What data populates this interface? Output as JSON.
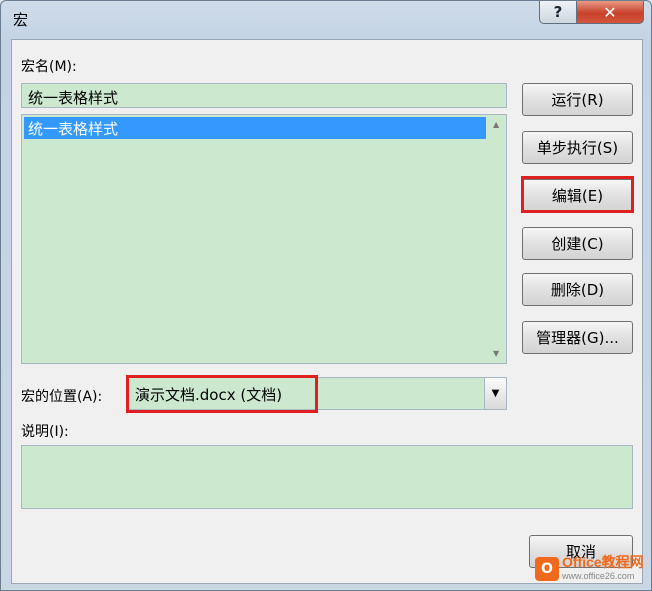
{
  "window": {
    "title": "宏",
    "help_symbol": "?",
    "close_symbol": "✕"
  },
  "macro_name": {
    "label": "宏名(M):",
    "value": "统一表格样式"
  },
  "macro_list": {
    "items": [
      "统一表格样式"
    ],
    "selected_index": 0
  },
  "macros_in": {
    "label": "宏的位置(A):",
    "value": "演示文档.docx (文档)"
  },
  "description": {
    "label": "说明(I):",
    "value": ""
  },
  "buttons": {
    "run": "运行(R)",
    "step_into": "单步执行(S)",
    "edit": "编辑(E)",
    "create": "创建(C)",
    "delete": "删除(D)",
    "organizer": "管理器(G)...",
    "cancel": "取消"
  },
  "highlight_color": "#e02020",
  "field_background": "#cce8cf",
  "watermark": {
    "main": "Office教程网",
    "sub": "www.office26.com"
  }
}
